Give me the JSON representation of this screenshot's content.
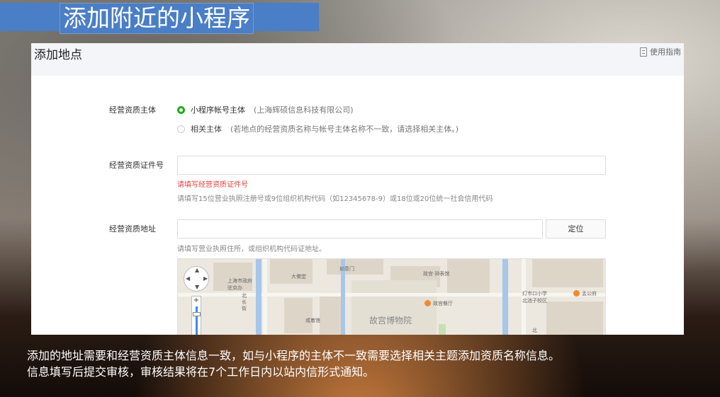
{
  "slide": {
    "title": "添加附近的小程序",
    "caption_line1": "添加的地址需要和经营资质主体信息一致，如与小程序的主体不一致需要选择相关主题添加资质名称信息。",
    "caption_line2": "信息填写后提交审核，审核结果将在7个工作日内以站内信形式通知。"
  },
  "page": {
    "title": "添加地点",
    "guide_link": "使用指南",
    "guide_icon": "document-icon"
  },
  "form": {
    "subject": {
      "label": "经营资质主体",
      "options": [
        {
          "label": "小程序帐号主体",
          "note": "(上海辉硕信息科技有限公司)",
          "selected": true
        },
        {
          "label": "相关主体",
          "note": "(若地点的经营资质名称与帐号主体名称不一致，请选择相关主体。)",
          "selected": false
        }
      ]
    },
    "license": {
      "label": "经营资质证件号",
      "value": "",
      "error": "请填写经营资质证件号",
      "hint": "请填写15位营业执照注册号或9位组织机构代码（如12345678-9）或18位或20位统一社会信用代码"
    },
    "address": {
      "label": "经营资质地址",
      "value": "",
      "locate_button": "定位",
      "hint": "请填写营业执照住所，或组织机构代码证地址。"
    }
  },
  "map": {
    "labels": {
      "gov": "上海市政府\n驻京办",
      "dasheng": "大佛堂",
      "ruyimen": "如意门",
      "gugong_bell": "故宫·钟表馆",
      "gugong_canteen": "故宫餐厅",
      "museum": "故宫博物院",
      "school": "灯市口小学\n北池子校区",
      "hall": "咸着馆",
      "north_street": "北\n长\n街",
      "right_poi": "孟公府",
      "north": "北"
    },
    "zoom_plus": "+"
  },
  "colors": {
    "accent": "#1aad19",
    "error": "#e64340",
    "title_bar": "#4a7ec6"
  }
}
